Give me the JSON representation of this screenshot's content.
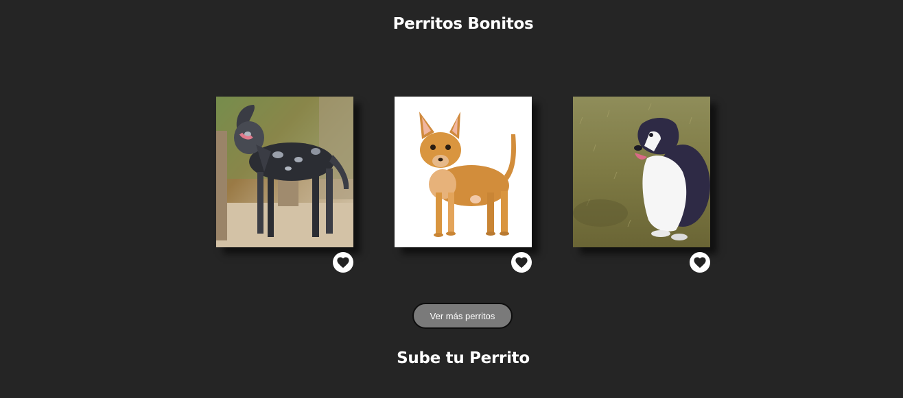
{
  "header": {
    "title": "Perritos Bonitos"
  },
  "gallery": {
    "cards": [
      {
        "image": "catahoula-leopard-dog-photo",
        "like_icon": "heart-icon"
      },
      {
        "image": "chihuahua-photo",
        "like_icon": "heart-icon"
      },
      {
        "image": "border-collie-photo",
        "like_icon": "heart-icon"
      }
    ],
    "more_button_label": "Ver más perritos"
  },
  "upload": {
    "title": "Sube tu Perrito"
  },
  "colors": {
    "background": "#252525",
    "text": "#ffffff",
    "button": "#7a7a7a",
    "heart": "#222222"
  }
}
